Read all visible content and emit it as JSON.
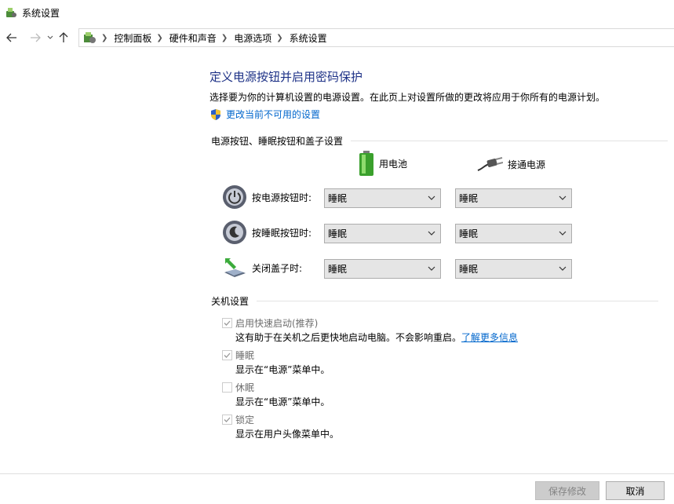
{
  "window": {
    "title": "系统设置"
  },
  "nav": {
    "breadcrumbs": [
      "控制面板",
      "硬件和声音",
      "电源选项",
      "系统设置"
    ]
  },
  "page": {
    "heading": "定义电源按钮并启用密码保护",
    "description": "选择要为你的计算机设置的电源设置。在此页上对设置所做的更改将应用于你所有的电源计划。",
    "admin_link": "更改当前不可用的设置"
  },
  "power_buttons": {
    "section_title": "电源按钮、睡眠按钮和盖子设置",
    "col_battery": "用电池",
    "col_plugged": "接通电源",
    "rows": [
      {
        "label": "按电源按钮时:",
        "battery": "睡眠",
        "plugged": "睡眠"
      },
      {
        "label": "按睡眠按钮时:",
        "battery": "睡眠",
        "plugged": "睡眠"
      },
      {
        "label": "关闭盖子时:",
        "battery": "睡眠",
        "plugged": "睡眠"
      }
    ]
  },
  "shutdown": {
    "section_title": "关机设置",
    "items": [
      {
        "label": "启用快速启动(推荐)",
        "desc": "这有助于在关机之后更快地启动电脑。不会影响重启。",
        "link": "了解更多信息",
        "checked": true
      },
      {
        "label": "睡眠",
        "desc": "显示在“电源”菜单中。",
        "checked": true
      },
      {
        "label": "休眠",
        "desc": "显示在“电源”菜单中。",
        "checked": false
      },
      {
        "label": "锁定",
        "desc": "显示在用户头像菜单中。",
        "checked": true
      }
    ]
  },
  "footer": {
    "save": "保存修改",
    "cancel": "取消"
  },
  "colors": {
    "heading": "#1e3287",
    "link": "#0066cc"
  }
}
